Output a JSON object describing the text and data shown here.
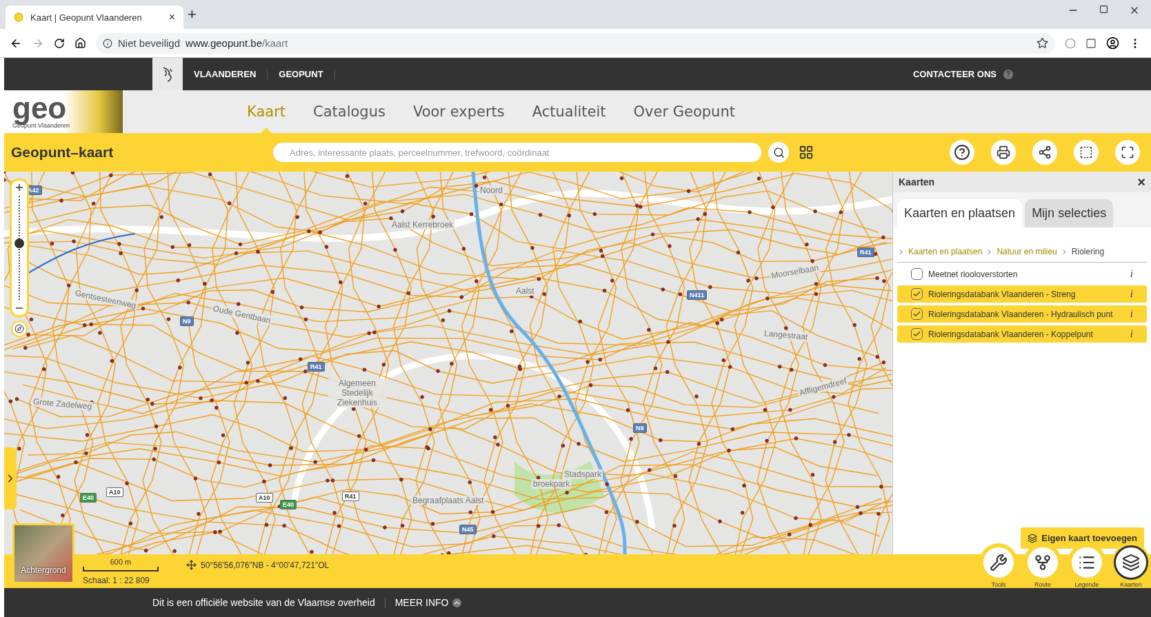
{
  "browser": {
    "tab_title": "Kaart | Geopunt Vlaanderen",
    "tab_close": "×",
    "new_tab": "+",
    "security": "Niet beveiligd",
    "url_host": "www.geopunt.be",
    "url_path": "/kaart"
  },
  "topbar": {
    "links": [
      "VLAANDEREN",
      "GEOPUNT"
    ],
    "contact": "CONTACTEER ONS",
    "help": "?"
  },
  "header": {
    "logo": "geo",
    "logo_sub": "Geopunt Vlaanderen",
    "nav": [
      {
        "label": "Kaart",
        "selected": true
      },
      {
        "label": "Catalogus",
        "selected": false
      },
      {
        "label": "Voor experts",
        "selected": false
      },
      {
        "label": "Actualiteit",
        "selected": false
      },
      {
        "label": "Over Geopunt",
        "selected": false
      }
    ]
  },
  "toolbar": {
    "title": "Geopunt–kaart",
    "search_placeholder": "Adres, interessante plaats, perceelnummer, trefwoord, coördinaat"
  },
  "map": {
    "zoom": {
      "level": 0.55
    },
    "labels": [
      {
        "text": "Noord",
        "kind": "place"
      },
      {
        "text": "Aalst Kerrebroek",
        "kind": "place"
      },
      {
        "text": "Aalst",
        "kind": "place"
      },
      {
        "text": "Algemeen Stedelijk Ziekenhuis",
        "kind": "place"
      },
      {
        "text": "Stadspark",
        "kind": "place"
      },
      {
        "text": "broekpark",
        "kind": "place"
      },
      {
        "text": "Begraafplaats Aalst",
        "kind": "place"
      },
      {
        "text": "Gentsesteenweg",
        "kind": "street"
      },
      {
        "text": "Oude Gentbaan",
        "kind": "street"
      },
      {
        "text": "Grote Zadelweg",
        "kind": "street"
      },
      {
        "text": "Langestraat",
        "kind": "street"
      },
      {
        "text": "Affligemdreef",
        "kind": "street"
      },
      {
        "text": "Moorselbaan",
        "kind": "street"
      },
      {
        "text": "A42",
        "kind": "shield"
      },
      {
        "text": "N9",
        "kind": "shield"
      },
      {
        "text": "R41",
        "kind": "shield"
      },
      {
        "text": "N9",
        "kind": "shield"
      },
      {
        "text": "E40",
        "kind": "shield-green"
      },
      {
        "text": "A10",
        "kind": "shield-white"
      },
      {
        "text": "A10",
        "kind": "shield-white"
      },
      {
        "text": "E40",
        "kind": "shield-green"
      },
      {
        "text": "R41",
        "kind": "shield-white"
      },
      {
        "text": "N45",
        "kind": "shield"
      },
      {
        "text": "N411",
        "kind": "shield"
      },
      {
        "text": "R41",
        "kind": "shield"
      }
    ]
  },
  "panel": {
    "title": "Kaarten",
    "close": "×",
    "tabs": [
      {
        "label": "Kaarten en plaatsen",
        "selected": true
      },
      {
        "label": "Mijn selecties",
        "selected": false
      }
    ],
    "breadcrumb": [
      {
        "label": "Kaarten en plaatsen",
        "kind": "link"
      },
      {
        "label": "Natuur en milieu",
        "kind": "link"
      },
      {
        "label": "Riolering",
        "kind": "current"
      }
    ],
    "layers": [
      {
        "name": "Meetnet riooloverstorten",
        "checked": false,
        "info": "i"
      },
      {
        "name": "Rioleringsdatabank Vlaanderen - Streng",
        "checked": true,
        "info": "i"
      },
      {
        "name": "Rioleringsdatabank Vlaanderen - Hydraulisch punt",
        "checked": true,
        "info": "i"
      },
      {
        "name": "Rioleringsdatabank Vlaanderen - Koppelpunt",
        "checked": true,
        "info": "i"
      }
    ],
    "add_button": "Eigen kaart toevoegen"
  },
  "status": {
    "background_label": "Achtergrond",
    "scale_bar": "600 m",
    "scale": "Schaal: 1 : 22 809",
    "coordinate": "50°56'56,076\"NB - 4°00'47,721\"OL"
  },
  "dock": [
    {
      "label": "Tools",
      "kind": "tools",
      "selected": false
    },
    {
      "label": "Route",
      "kind": "route",
      "selected": false
    },
    {
      "label": "Legende",
      "kind": "legend",
      "selected": false
    },
    {
      "label": "Kaarten",
      "kind": "layers",
      "selected": true
    }
  ],
  "footer": {
    "text": "Dit is een officiële website van de Vlaamse overheid",
    "more": "MEER INFO"
  }
}
